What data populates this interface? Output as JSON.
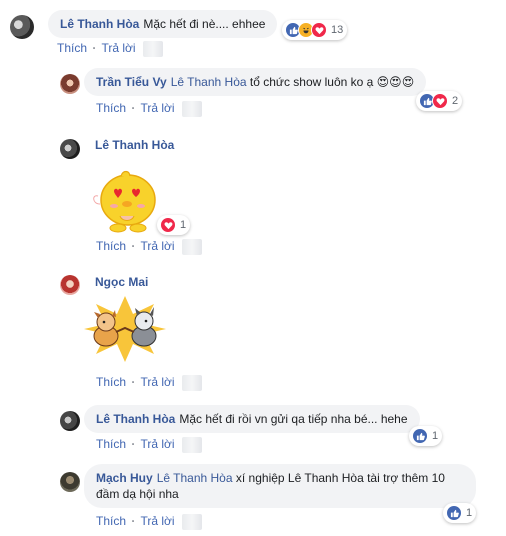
{
  "comments": [
    {
      "author": "Lê Thanh Hòa",
      "text": "Mặc hết đi nè.... ehhee",
      "actions": {
        "like": "Thích",
        "sep": "·",
        "reply": "Trả lời"
      },
      "reactions": {
        "icons": [
          "like-icon",
          "haha-icon",
          "love-icon"
        ],
        "count": "13"
      }
    }
  ],
  "replies": [
    {
      "author": "Trần Tiểu Vy",
      "mention": "Lê Thanh Hòa",
      "text": "tổ chức show luôn ko ạ",
      "emoji": "😍😍😍",
      "actions": {
        "like": "Thích",
        "sep": "·",
        "reply": "Trả lời"
      },
      "reactions": {
        "icons": [
          "like-icon",
          "love-icon"
        ],
        "count": "2"
      }
    },
    {
      "author": "Lê Thanh Hòa",
      "sticker": "heart-eyes-chick-sticker",
      "actions": {
        "like": "Thích",
        "sep": "·",
        "reply": "Trả lời"
      },
      "reactions": {
        "icons": [
          "love-icon"
        ],
        "count": "1"
      }
    },
    {
      "author": "Ngọc Mai",
      "sticker": "dogs-high-five-sticker",
      "actions": {
        "like": "Thích",
        "sep": "·",
        "reply": "Trả lời"
      }
    },
    {
      "author": "Lê Thanh Hòa",
      "text": "Mặc hết đi rồi vn gửi qa tiếp nha bé... hehe",
      "actions": {
        "like": "Thích",
        "sep": "·",
        "reply": "Trả lời"
      },
      "reactions": {
        "icons": [
          "like-icon"
        ],
        "count": "1"
      }
    },
    {
      "author": "Mạch Huy",
      "mention": "Lê Thanh Hòa",
      "text": "xí nghiệp Lê Thanh Hòa tài trợ thêm 10 đầm dạ hội nha",
      "actions": {
        "like": "Thích",
        "sep": "·",
        "reply": "Trả lời"
      },
      "reactions": {
        "icons": [
          "like-icon"
        ],
        "count": "1"
      }
    }
  ]
}
